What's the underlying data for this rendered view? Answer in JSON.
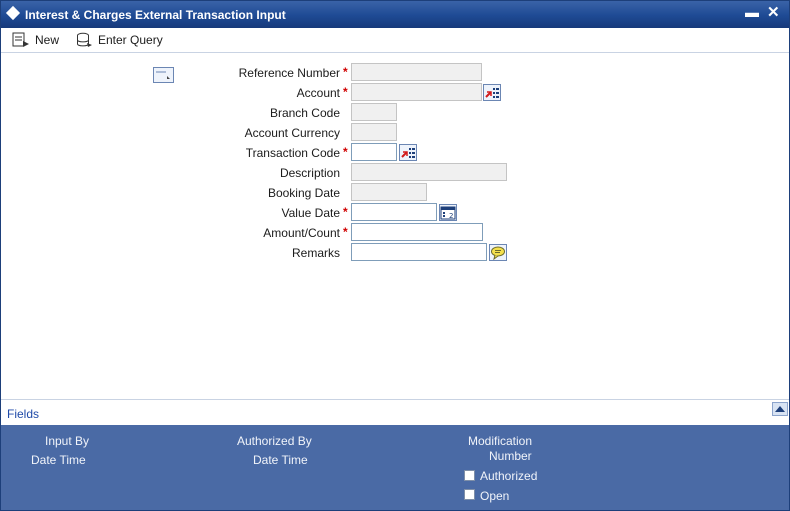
{
  "window": {
    "title": "Interest & Charges External Transaction Input",
    "minimize_glyph": "▬",
    "close_glyph": "✕"
  },
  "toolbar": {
    "new_label": "New",
    "enter_query_label": "Enter Query"
  },
  "form": {
    "reference_number": {
      "label": "Reference Number",
      "value": ""
    },
    "account": {
      "label": "Account",
      "value": ""
    },
    "branch_code": {
      "label": "Branch Code",
      "value": ""
    },
    "account_currency": {
      "label": "Account Currency",
      "value": ""
    },
    "transaction_code": {
      "label": "Transaction Code",
      "value": ""
    },
    "description": {
      "label": "Description",
      "value": ""
    },
    "booking_date": {
      "label": "Booking Date",
      "value": ""
    },
    "value_date": {
      "label": "Value Date",
      "value": ""
    },
    "amount_count": {
      "label": "Amount/Count",
      "value": ""
    },
    "remarks": {
      "label": "Remarks",
      "value": ""
    },
    "required_marker": "*"
  },
  "fields_section": {
    "label": "Fields"
  },
  "audit": {
    "input_by": "Input By",
    "input_date_time": "Date Time",
    "authorized_by": "Authorized By",
    "authorized_date_time": "Date Time",
    "modification": "Modification",
    "number": "Number",
    "authorized_label": "Authorized",
    "open_label": "Open"
  },
  "colors": {
    "titlebar": "#1e4a94",
    "audit_panel": "#4a6aa5",
    "required": "#d00000",
    "fields_link": "#1f4aa8"
  },
  "icons": [
    "new-icon",
    "enter-query-icon",
    "lov-icon",
    "calendar-icon",
    "remarks-icon",
    "collapse-up-icon"
  ]
}
